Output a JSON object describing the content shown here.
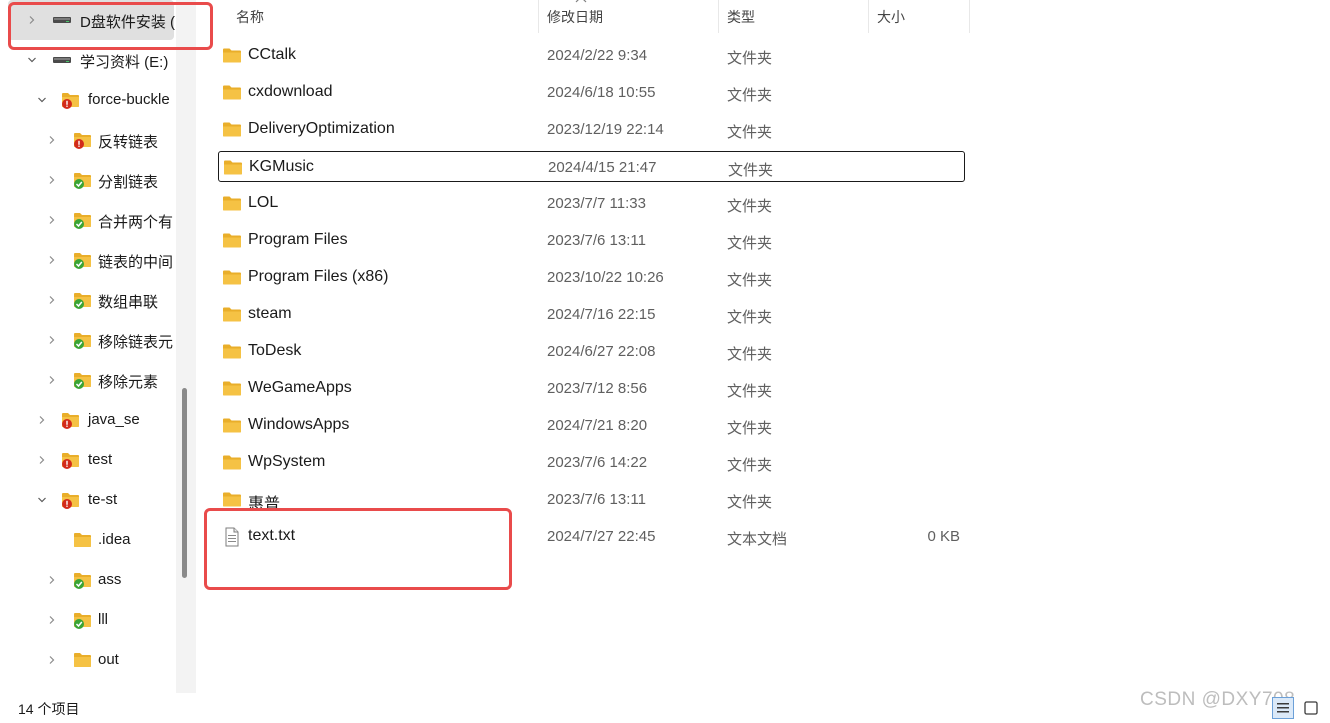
{
  "nav": {
    "items": [
      {
        "label": "D盘软件安装 (",
        "level": 0,
        "expander": "collapsed",
        "icon": "drive-icon",
        "selected": true
      },
      {
        "label": "学习资料 (E:)",
        "level": 0,
        "expander": "expanded",
        "icon": "drive-icon"
      },
      {
        "label": "force-buckle",
        "level": 1,
        "expander": "expanded",
        "icon": "folder-conflict-icon"
      },
      {
        "label": "反转链表",
        "level": 2,
        "expander": "collapsed",
        "icon": "folder-conflict-icon"
      },
      {
        "label": "分割链表",
        "level": 2,
        "expander": "collapsed",
        "icon": "folder-synced-icon"
      },
      {
        "label": "合并两个有",
        "level": 2,
        "expander": "collapsed",
        "icon": "folder-synced-icon"
      },
      {
        "label": "链表的中间",
        "level": 2,
        "expander": "collapsed",
        "icon": "folder-synced-icon"
      },
      {
        "label": "数组串联",
        "level": 2,
        "expander": "collapsed",
        "icon": "folder-synced-icon"
      },
      {
        "label": "移除链表元",
        "level": 2,
        "expander": "collapsed",
        "icon": "folder-synced-icon"
      },
      {
        "label": "移除元素",
        "level": 2,
        "expander": "collapsed",
        "icon": "folder-synced-icon"
      },
      {
        "label": "java_se",
        "level": 1,
        "expander": "collapsed",
        "icon": "folder-conflict-icon"
      },
      {
        "label": "test",
        "level": 1,
        "expander": "collapsed",
        "icon": "folder-conflict-icon"
      },
      {
        "label": "te-st",
        "level": 1,
        "expander": "expanded",
        "icon": "folder-conflict-icon"
      },
      {
        "label": ".idea",
        "level": 2,
        "expander": "none",
        "icon": "folder-icon"
      },
      {
        "label": "ass",
        "level": 2,
        "expander": "collapsed",
        "icon": "folder-synced-icon"
      },
      {
        "label": "lll",
        "level": 2,
        "expander": "collapsed",
        "icon": "folder-synced-icon"
      },
      {
        "label": "out",
        "level": 2,
        "expander": "collapsed",
        "icon": "folder-icon"
      }
    ]
  },
  "header": {
    "name": "名称",
    "date": "修改日期",
    "type": "类型",
    "size": "大小"
  },
  "files": [
    {
      "name": "CCtalk",
      "date": "2024/2/22 9:34",
      "type": "文件夹",
      "size": "",
      "icon": "folder-icon"
    },
    {
      "name": "cxdownload",
      "date": "2024/6/18 10:55",
      "type": "文件夹",
      "size": "",
      "icon": "folder-icon"
    },
    {
      "name": "DeliveryOptimization",
      "date": "2023/12/19 22:14",
      "type": "文件夹",
      "size": "",
      "icon": "folder-icon"
    },
    {
      "name": "KGMusic",
      "date": "2024/4/15 21:47",
      "type": "文件夹",
      "size": "",
      "icon": "folder-icon",
      "focused": true
    },
    {
      "name": "LOL",
      "date": "2023/7/7 11:33",
      "type": "文件夹",
      "size": "",
      "icon": "folder-icon"
    },
    {
      "name": "Program Files",
      "date": "2023/7/6 13:11",
      "type": "文件夹",
      "size": "",
      "icon": "folder-icon"
    },
    {
      "name": "Program Files (x86)",
      "date": "2023/10/22 10:26",
      "type": "文件夹",
      "size": "",
      "icon": "folder-icon"
    },
    {
      "name": "steam",
      "date": "2024/7/16 22:15",
      "type": "文件夹",
      "size": "",
      "icon": "folder-icon"
    },
    {
      "name": "ToDesk",
      "date": "2024/6/27 22:08",
      "type": "文件夹",
      "size": "",
      "icon": "folder-icon"
    },
    {
      "name": "WeGameApps",
      "date": "2023/7/12 8:56",
      "type": "文件夹",
      "size": "",
      "icon": "folder-icon"
    },
    {
      "name": "WindowsApps",
      "date": "2024/7/21 8:20",
      "type": "文件夹",
      "size": "",
      "icon": "folder-icon"
    },
    {
      "name": "WpSystem",
      "date": "2023/7/6 14:22",
      "type": "文件夹",
      "size": "",
      "icon": "folder-icon"
    },
    {
      "name": "惠普",
      "date": "2023/7/6 13:11",
      "type": "文件夹",
      "size": "",
      "icon": "folder-icon"
    },
    {
      "name": "text.txt",
      "date": "2024/7/27 22:45",
      "type": "文本文档",
      "size": "0 KB",
      "icon": "text-file-icon"
    }
  ],
  "status": {
    "count": "14 个项目"
  },
  "watermark": "CSDN @DXY708",
  "colors": {
    "annotation": "#e94b4b",
    "folder": "#f5c244",
    "selection": "#e0e0e0"
  }
}
